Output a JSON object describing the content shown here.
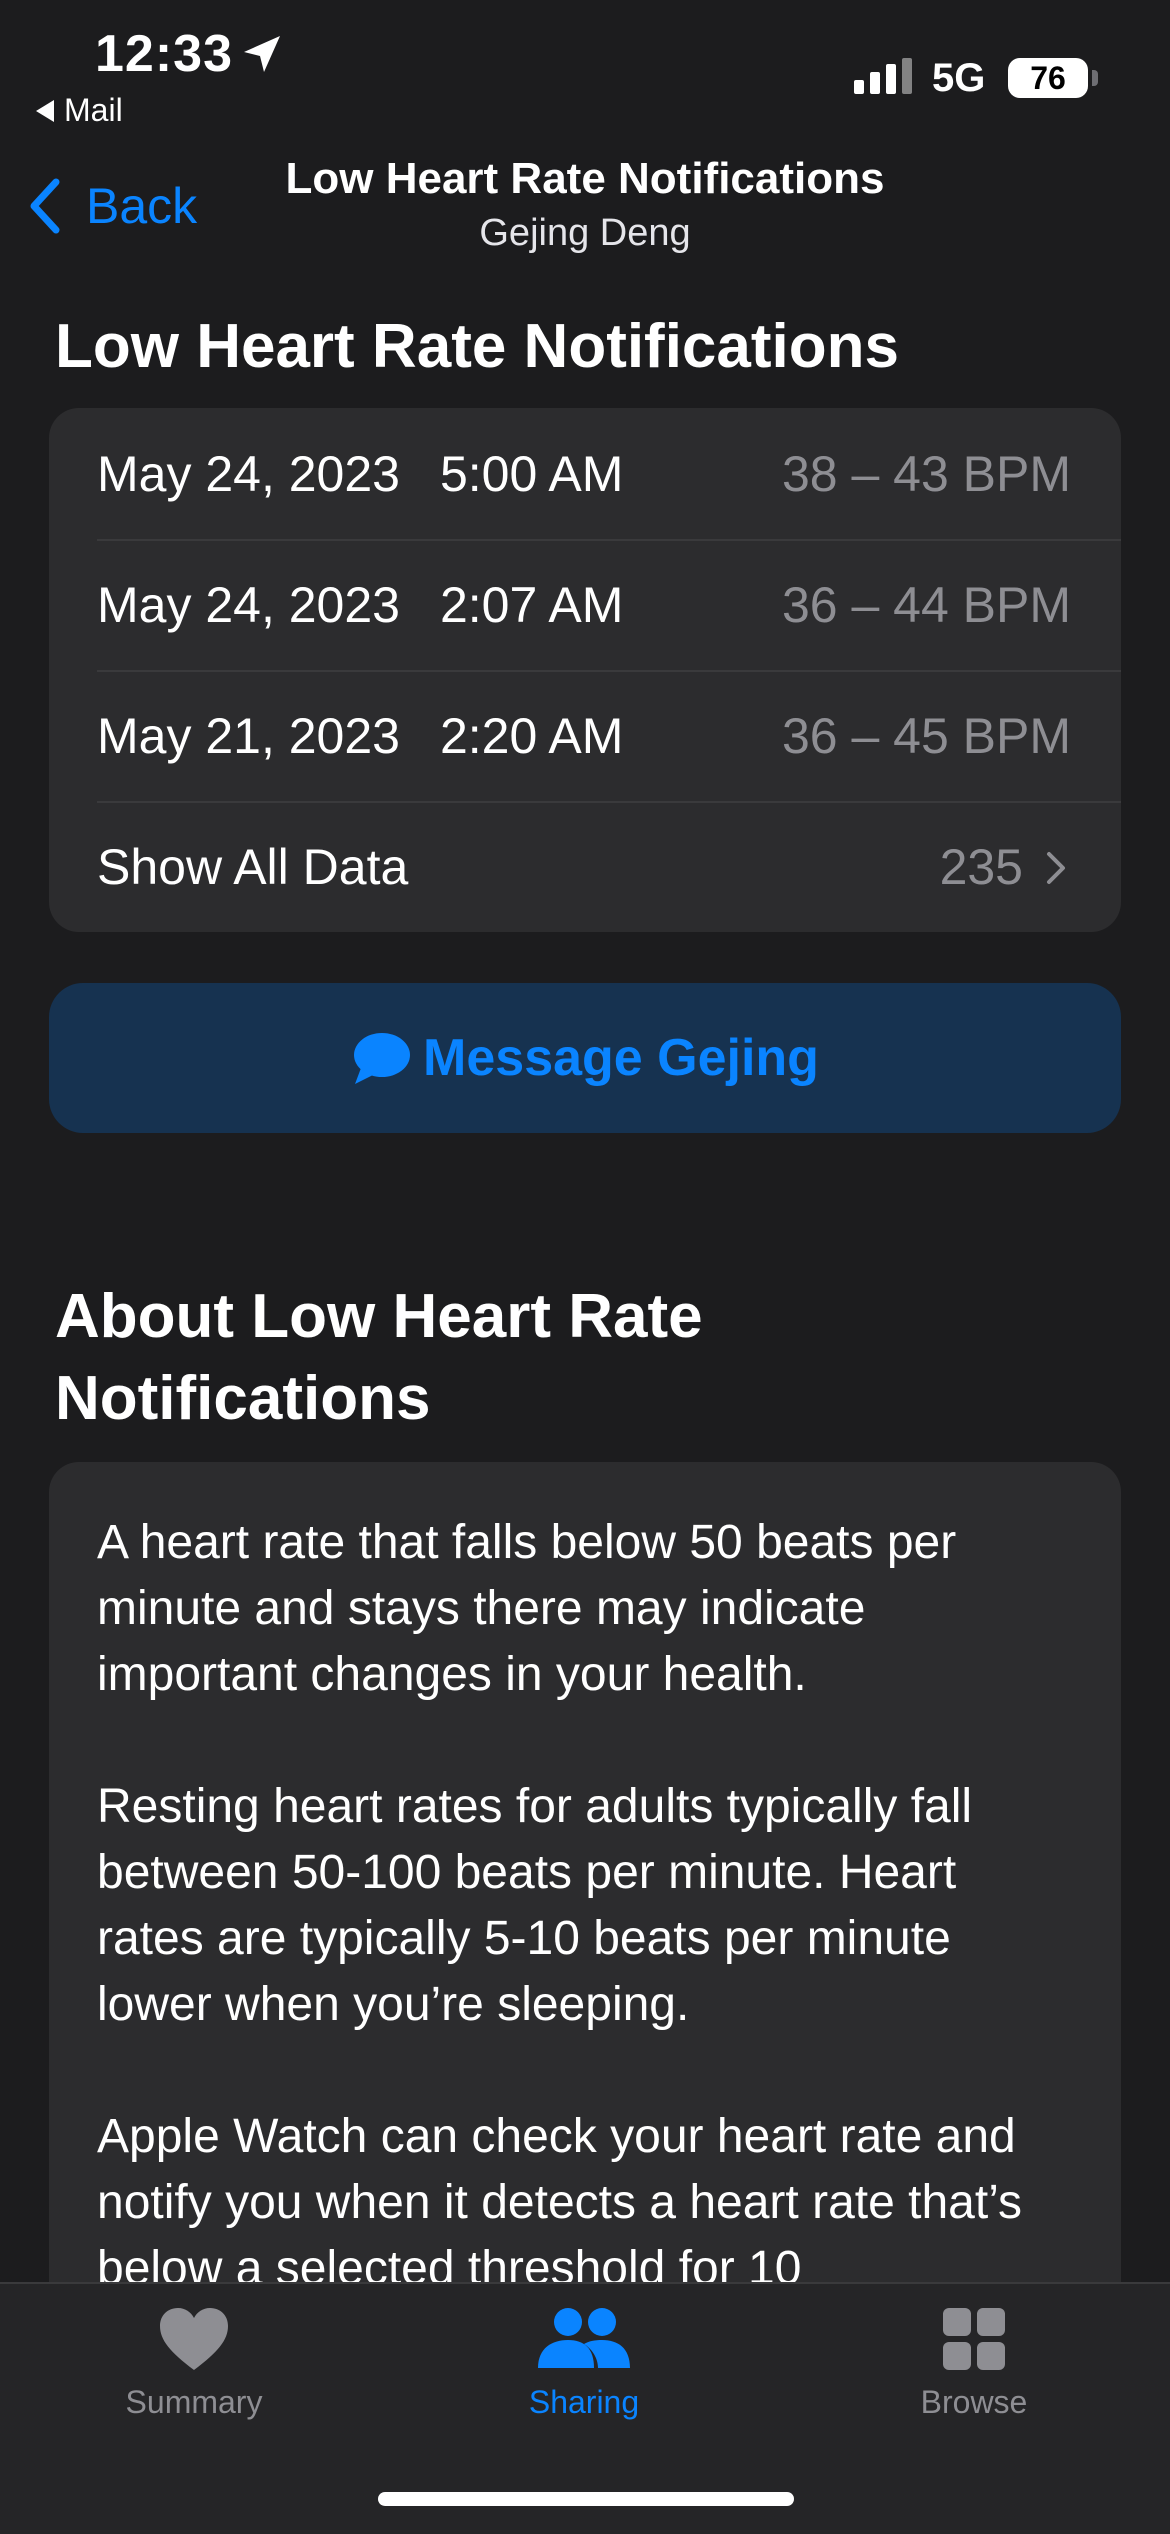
{
  "status_bar": {
    "time": "12:33",
    "back_app": "Mail",
    "network": "5G",
    "battery": "76"
  },
  "nav": {
    "back_label": "Back",
    "title": "Low Heart Rate Notifications",
    "subtitle": "Gejing Deng"
  },
  "notifications": {
    "title": "Low Heart Rate Notifications",
    "rows": [
      {
        "date": "May 24, 2023",
        "time": "5:00 AM",
        "bpm": "38 – 43 BPM"
      },
      {
        "date": "May 24, 2023",
        "time": "2:07 AM",
        "bpm": "36 – 44 BPM"
      },
      {
        "date": "May 21, 2023",
        "time": "2:20 AM",
        "bpm": "36 – 45 BPM"
      }
    ],
    "show_all": {
      "label": "Show All Data",
      "count": "235"
    }
  },
  "message_button": {
    "label": "Message Gejing"
  },
  "about": {
    "title_line1": "About Low Heart Rate",
    "title_line2": "Notifications",
    "paragraphs": [
      "A heart rate that falls below 50 beats per minute and stays there may indicate important changes in your health.",
      "Resting heart rates for adults typically fall between 50-100 beats per minute. Heart rates are typically 5-10 beats per minute lower when you’re sleeping.",
      "Apple Watch can check your heart rate and notify you when it detects a heart rate that’s below a selected threshold for 10"
    ]
  },
  "tabs": [
    {
      "label": "Summary",
      "icon": "heart-icon",
      "active": false
    },
    {
      "label": "Sharing",
      "icon": "people-icon",
      "active": true
    },
    {
      "label": "Browse",
      "icon": "grid-icon",
      "active": false
    }
  ],
  "colors": {
    "accent": "#0a84ff",
    "background": "#1c1c1e",
    "card": "#2c2c2e",
    "secondary_text": "#8e8e93",
    "inactive_tab": "#8e8e93"
  }
}
